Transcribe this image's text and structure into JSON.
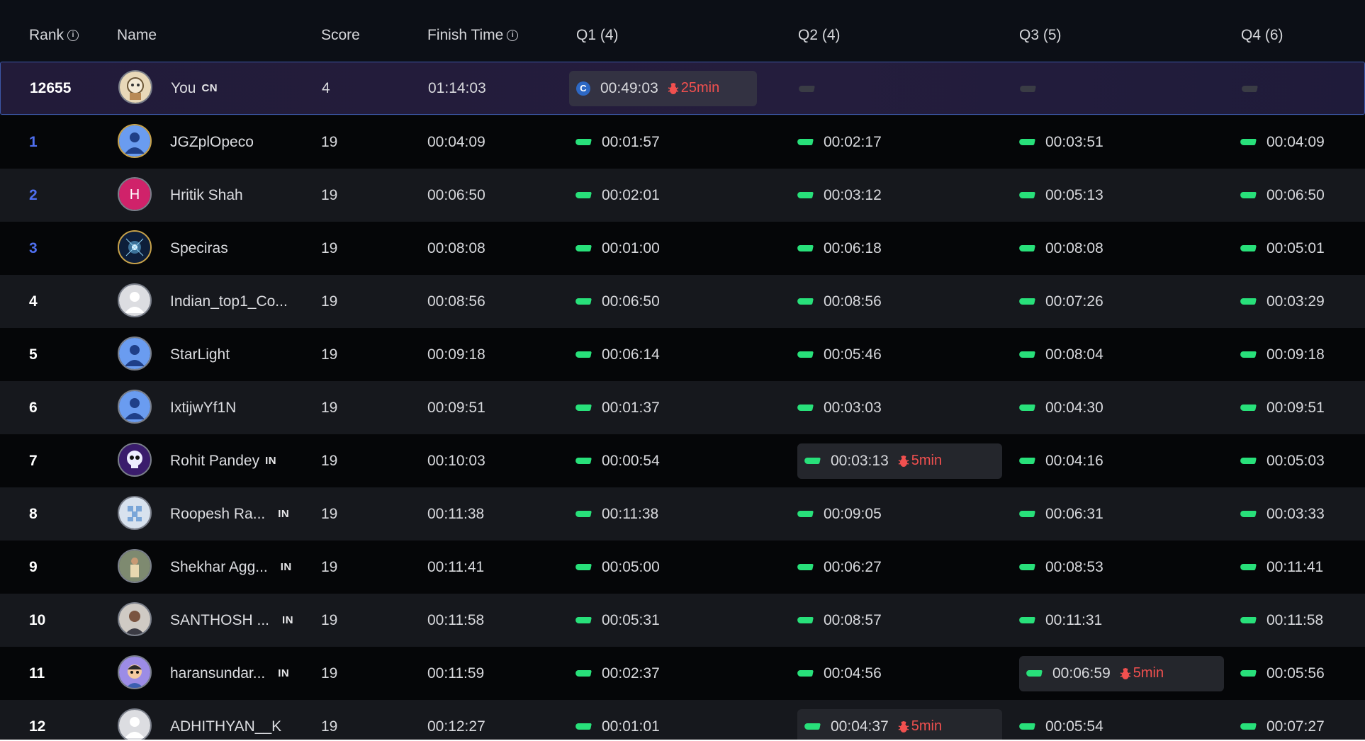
{
  "header": {
    "rank": "Rank",
    "name": "Name",
    "score": "Score",
    "finish_time": "Finish Time",
    "q1": "Q1 (4)",
    "q2": "Q2 (4)",
    "q3": "Q3 (5)",
    "q4": "Q4 (6)"
  },
  "me": {
    "rank": "12655",
    "name": "You",
    "country": "CN",
    "score": "4",
    "finish": "01:14:03",
    "q1_time": "00:49:03",
    "q1_penalty": "25min"
  },
  "rows": [
    {
      "rank": "1",
      "name": "JGZplOpeco",
      "country": "",
      "score": "19",
      "finish": "00:04:09",
      "q": [
        {
          "t": "00:01:57"
        },
        {
          "t": "00:02:17"
        },
        {
          "t": "00:03:51"
        },
        {
          "t": "00:04:09"
        }
      ]
    },
    {
      "rank": "2",
      "name": "Hritik Shah",
      "country": "",
      "score": "19",
      "finish": "00:06:50",
      "q": [
        {
          "t": "00:02:01"
        },
        {
          "t": "00:03:12"
        },
        {
          "t": "00:05:13"
        },
        {
          "t": "00:06:50"
        }
      ]
    },
    {
      "rank": "3",
      "name": "Speciras",
      "country": "",
      "score": "19",
      "finish": "00:08:08",
      "q": [
        {
          "t": "00:01:00"
        },
        {
          "t": "00:06:18"
        },
        {
          "t": "00:08:08"
        },
        {
          "t": "00:05:01"
        }
      ]
    },
    {
      "rank": "4",
      "name": "Indian_top1_Co...",
      "country": "",
      "score": "19",
      "finish": "00:08:56",
      "q": [
        {
          "t": "00:06:50"
        },
        {
          "t": "00:08:56"
        },
        {
          "t": "00:07:26"
        },
        {
          "t": "00:03:29"
        }
      ]
    },
    {
      "rank": "5",
      "name": "StarLight",
      "country": "",
      "score": "19",
      "finish": "00:09:18",
      "q": [
        {
          "t": "00:06:14"
        },
        {
          "t": "00:05:46"
        },
        {
          "t": "00:08:04"
        },
        {
          "t": "00:09:18"
        }
      ]
    },
    {
      "rank": "6",
      "name": "IxtijwYf1N",
      "country": "",
      "score": "19",
      "finish": "00:09:51",
      "q": [
        {
          "t": "00:01:37"
        },
        {
          "t": "00:03:03"
        },
        {
          "t": "00:04:30"
        },
        {
          "t": "00:09:51"
        }
      ]
    },
    {
      "rank": "7",
      "name": "Rohit Pandey",
      "country": "IN",
      "score": "19",
      "finish": "00:10:03",
      "q": [
        {
          "t": "00:00:54"
        },
        {
          "t": "00:03:13",
          "p": "5min"
        },
        {
          "t": "00:04:16"
        },
        {
          "t": "00:05:03"
        }
      ]
    },
    {
      "rank": "8",
      "name": "Roopesh Ra...",
      "country": "IN",
      "score": "19",
      "finish": "00:11:38",
      "q": [
        {
          "t": "00:11:38"
        },
        {
          "t": "00:09:05"
        },
        {
          "t": "00:06:31"
        },
        {
          "t": "00:03:33"
        }
      ]
    },
    {
      "rank": "9",
      "name": "Shekhar Agg...",
      "country": "IN",
      "score": "19",
      "finish": "00:11:41",
      "q": [
        {
          "t": "00:05:00"
        },
        {
          "t": "00:06:27"
        },
        {
          "t": "00:08:53"
        },
        {
          "t": "00:11:41"
        }
      ]
    },
    {
      "rank": "10",
      "name": "SANTHOSH ...",
      "country": "IN",
      "score": "19",
      "finish": "00:11:58",
      "q": [
        {
          "t": "00:05:31"
        },
        {
          "t": "00:08:57"
        },
        {
          "t": "00:11:31"
        },
        {
          "t": "00:11:58"
        }
      ]
    },
    {
      "rank": "11",
      "name": "haransundar...",
      "country": "IN",
      "score": "19",
      "finish": "00:11:59",
      "q": [
        {
          "t": "00:02:37"
        },
        {
          "t": "00:04:56"
        },
        {
          "t": "00:06:59",
          "p": "5min"
        },
        {
          "t": "00:05:56"
        }
      ]
    },
    {
      "rank": "12",
      "name": "ADHITHYAN__K",
      "country": "",
      "score": "19",
      "finish": "00:12:27",
      "q": [
        {
          "t": "00:01:01"
        },
        {
          "t": "00:04:37",
          "p": "5min"
        },
        {
          "t": "00:05:54"
        },
        {
          "t": "00:07:27"
        }
      ]
    }
  ],
  "colors": {
    "accepted": "#28e07a",
    "penalty": "#f1504f",
    "top_rank": "#4f6ff0"
  }
}
